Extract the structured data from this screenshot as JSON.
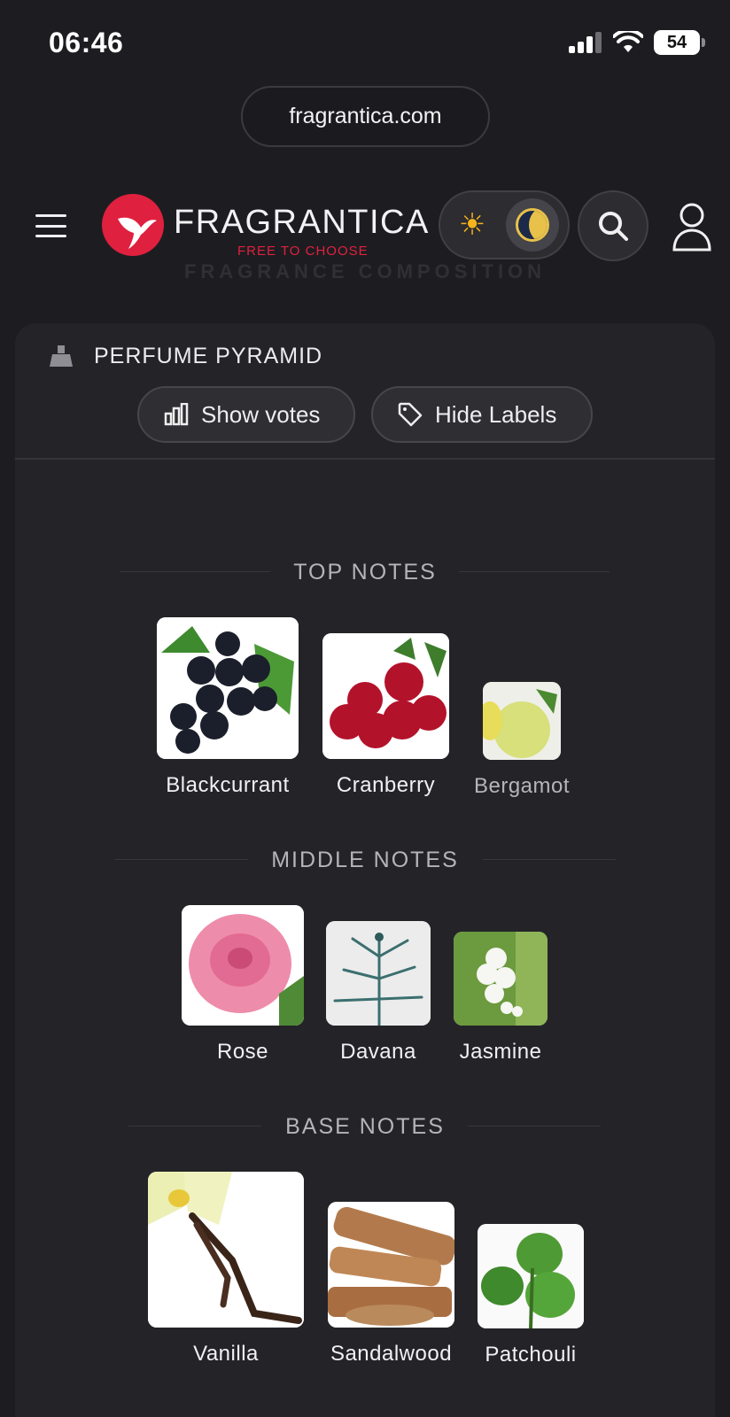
{
  "status_bar": {
    "time": "06:46",
    "battery": "54"
  },
  "browser": {
    "url": "fragrantica.com"
  },
  "header": {
    "logo_word": "FRAGRANTICA",
    "logo_tagline": "FREE TO CHOOSE",
    "ghost_heading": "FRAGRANCE COMPOSITION",
    "brand_color": "#e0203f"
  },
  "card": {
    "title": "PERFUME PYRAMID",
    "show_votes_label": "Show votes",
    "hide_labels_label": "Hide Labels"
  },
  "pyramid": {
    "top_title": "TOP NOTES",
    "top": [
      {
        "name": "Blackcurrant",
        "icon": "blackcurrant-image"
      },
      {
        "name": "Cranberry",
        "icon": "cranberry-image"
      },
      {
        "name": "Bergamot",
        "icon": "bergamot-image"
      }
    ],
    "middle_title": "MIDDLE NOTES",
    "middle": [
      {
        "name": "Rose",
        "icon": "rose-image"
      },
      {
        "name": "Davana",
        "icon": "davana-image"
      },
      {
        "name": "Jasmine",
        "icon": "jasmine-image"
      }
    ],
    "base_title": "BASE NOTES",
    "base": [
      {
        "name": "Vanilla",
        "icon": "vanilla-image"
      },
      {
        "name": "Sandalwood",
        "icon": "sandalwood-image"
      },
      {
        "name": "Patchouli",
        "icon": "patchouli-image"
      }
    ]
  }
}
